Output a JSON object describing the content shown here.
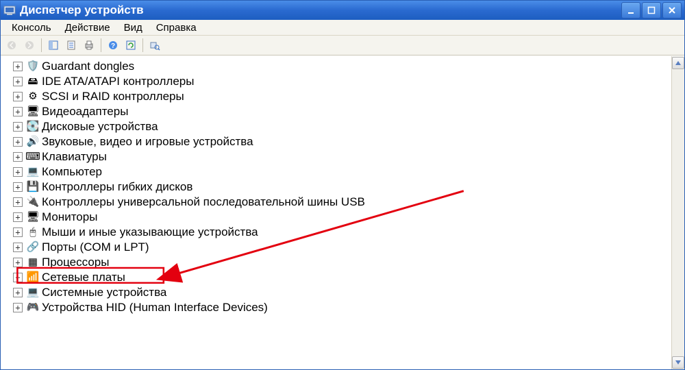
{
  "window": {
    "title": "Диспетчер устройств"
  },
  "menu": {
    "items": [
      "Консоль",
      "Действие",
      "Вид",
      "Справка"
    ]
  },
  "toolbar": {
    "buttons": [
      {
        "name": "back",
        "enabled": false
      },
      {
        "name": "forward",
        "enabled": false
      },
      {
        "name": "up",
        "enabled": true
      },
      {
        "name": "show-hide-tree",
        "enabled": true
      },
      {
        "name": "properties",
        "enabled": true
      },
      {
        "name": "print",
        "enabled": true
      },
      {
        "name": "help",
        "enabled": true
      },
      {
        "name": "refresh",
        "enabled": true
      },
      {
        "name": "scan-hardware",
        "enabled": true
      }
    ]
  },
  "tree": {
    "nodes": [
      {
        "icon": "dongle-icon",
        "glyph": "🛡️",
        "label": "Guardant dongles",
        "highlight": false
      },
      {
        "icon": "ide-icon",
        "glyph": "🖴",
        "label": "IDE ATA/ATAPI контроллеры",
        "highlight": false
      },
      {
        "icon": "scsi-icon",
        "glyph": "⚙",
        "label": "SCSI и RAID контроллеры",
        "highlight": false
      },
      {
        "icon": "display-icon",
        "glyph": "🖥",
        "label": "Видеоадаптеры",
        "highlight": false
      },
      {
        "icon": "disk-icon",
        "glyph": "💽",
        "label": "Дисковые устройства",
        "highlight": false
      },
      {
        "icon": "sound-icon",
        "glyph": "🔊",
        "label": "Звуковые, видео и игровые устройства",
        "highlight": false
      },
      {
        "icon": "keyboard-icon",
        "glyph": "⌨",
        "label": "Клавиатуры",
        "highlight": false
      },
      {
        "icon": "computer-icon",
        "glyph": "💻",
        "label": "Компьютер",
        "highlight": false
      },
      {
        "icon": "floppy-icon",
        "glyph": "💾",
        "label": "Контроллеры гибких дисков",
        "highlight": false
      },
      {
        "icon": "usb-icon",
        "glyph": "🔌",
        "label": "Контроллеры универсальной последовательной шины USB",
        "highlight": false
      },
      {
        "icon": "monitor-icon",
        "glyph": "🖥",
        "label": "Мониторы",
        "highlight": false
      },
      {
        "icon": "mouse-icon",
        "glyph": "🖱",
        "label": "Мыши и иные указывающие устройства",
        "highlight": false
      },
      {
        "icon": "ports-icon",
        "glyph": "🔗",
        "label": "Порты (COM и LPT)",
        "highlight": false
      },
      {
        "icon": "cpu-icon",
        "glyph": "▦",
        "label": "Процессоры",
        "highlight": false
      },
      {
        "icon": "network-icon",
        "glyph": "📶",
        "label": "Сетевые платы",
        "highlight": true
      },
      {
        "icon": "system-icon",
        "glyph": "💻",
        "label": "Системные устройства",
        "highlight": false
      },
      {
        "icon": "hid-icon",
        "glyph": "🎮",
        "label": "Устройства HID (Human Interface Devices)",
        "highlight": false
      }
    ]
  },
  "expander_glyph": "+",
  "expander_glyph_minus": "−",
  "annotation": {
    "arrow_color": "#e3000f"
  }
}
